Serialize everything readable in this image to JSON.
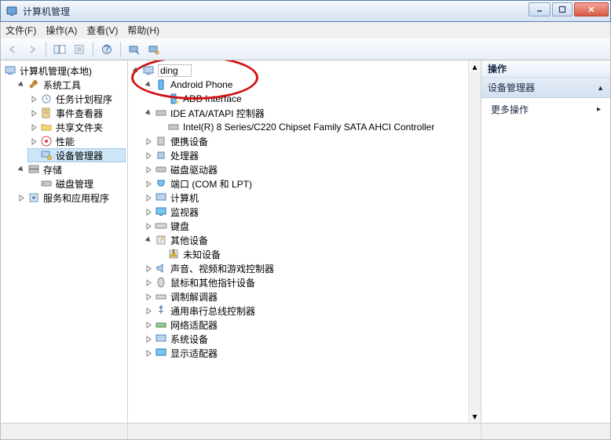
{
  "window": {
    "title": "计算机管理",
    "buttons": {
      "min": "–",
      "max": "▢",
      "close": "✕"
    }
  },
  "menu": {
    "file": "文件(F)",
    "action": "操作(A)",
    "view": "查看(V)",
    "help": "帮助(H)"
  },
  "leftTree": {
    "root": "计算机管理(本地)",
    "systemTools": "系统工具",
    "taskScheduler": "任务计划程序",
    "eventViewer": "事件查看器",
    "sharedFolders": "共享文件夹",
    "performance": "性能",
    "deviceManager": "设备管理器",
    "storage": "存储",
    "diskManagement": "磁盘管理",
    "services": "服务和应用程序"
  },
  "deviceTree": {
    "root": "ding",
    "androidPhone": "Android Phone",
    "adb": "ADB Interface",
    "ide": "IDE ATA/ATAPI 控制器",
    "ideChild": "Intel(R) 8 Series/C220 Chipset Family SATA AHCI Controller",
    "portable": "便携设备",
    "cpu": "处理器",
    "diskDrives": "磁盘驱动器",
    "ports": "端口 (COM 和 LPT)",
    "computer": "计算机",
    "monitor": "监视器",
    "keyboard": "键盘",
    "other": "其他设备",
    "unknown": "未知设备",
    "sound": "声音、视频和游戏控制器",
    "mouse": "鼠标和其他指针设备",
    "modem": "调制解调器",
    "usb": "通用串行总线控制器",
    "network": "网络适配器",
    "system": "系统设备",
    "display": "显示适配器"
  },
  "rightPane": {
    "header": "操作",
    "section": "设备管理器",
    "more": "更多操作"
  }
}
